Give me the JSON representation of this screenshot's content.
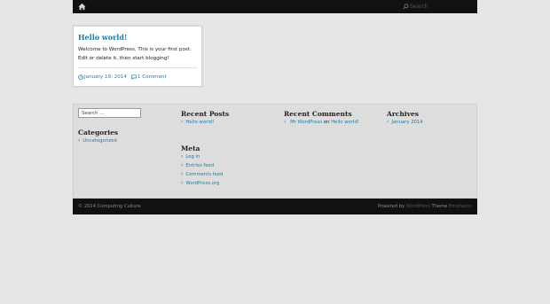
{
  "topbar": {
    "search_placeholder": "Search"
  },
  "post": {
    "title": "Hello world!",
    "excerpt": "Welcome to WordPress. This is your first post. Edit or delete it, then start blogging!",
    "date": "January 19, 2014",
    "comments": "1 Comment"
  },
  "widgets": {
    "search_placeholder": "Search ...",
    "categories_title": "Categories",
    "categories": [
      "Uncategorized"
    ],
    "recent_posts_title": "Recent Posts",
    "recent_posts": [
      "Hello world!"
    ],
    "meta_title": "Meta",
    "meta": [
      "Log in",
      "Entries feed",
      "Comments feed",
      "WordPress.org"
    ],
    "recent_comments_title": "Recent Comments",
    "recent_comment": {
      "author": "Mr WordPress",
      "on": "on",
      "post": "Hello world!"
    },
    "archives_title": "Archives",
    "archives": [
      "January 2014"
    ]
  },
  "footer": {
    "copyright": "© 2014 Computing Culture",
    "powered_by": "Powered by",
    "wordpress": "WordPress",
    "theme_label": "Theme",
    "theme_name": "Emphaino"
  },
  "colors": {
    "link": "#1a7ea5",
    "topbar_bg": "#111111",
    "page_bg": "#e6e6e6",
    "widget_bg": "#dddddd"
  },
  "icons": {
    "home": "home-icon",
    "search": "search-icon",
    "date": "clock-icon",
    "comments": "comment-icon"
  }
}
